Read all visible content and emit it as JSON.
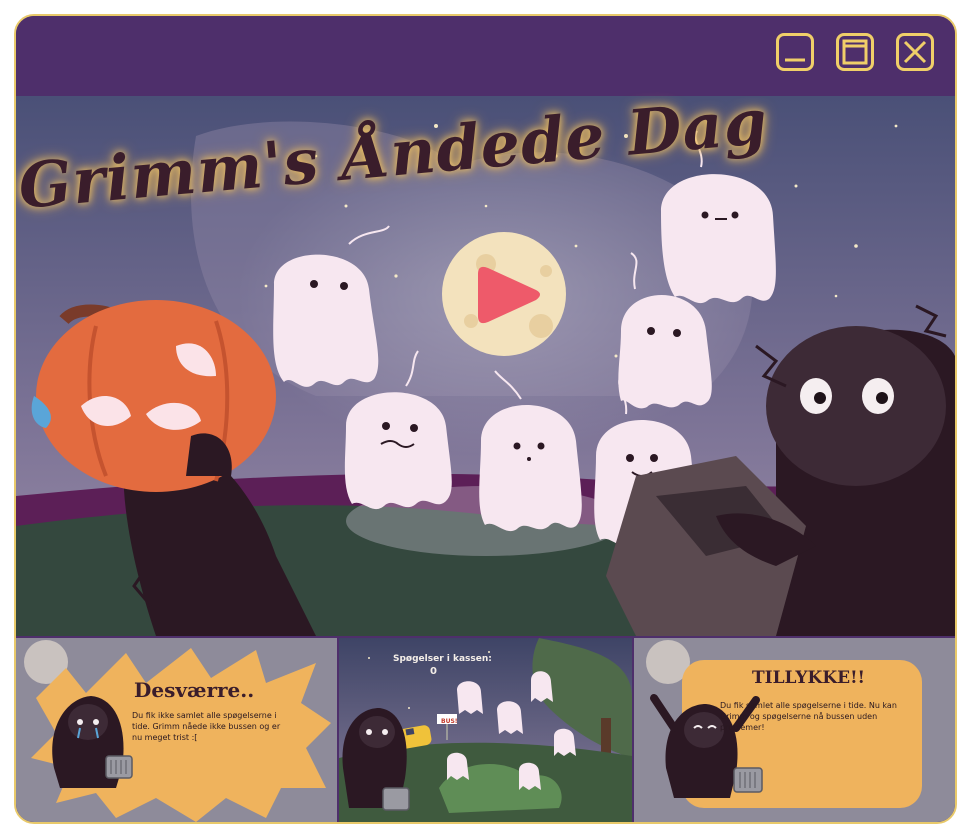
{
  "window": {
    "controls": [
      "minimize-icon",
      "maximize-icon",
      "close-icon"
    ],
    "accent": "#f0cf69",
    "frame_color": "#4e2f6b"
  },
  "hero": {
    "title": "Grimm's Åndede Dag",
    "play_button": "play-icon"
  },
  "lose_screen": {
    "title": "Desværre..",
    "text": "Du fik ikke samlet alle spøgelserne i tide. Grimm nåede ikke bussen og er nu meget trist :["
  },
  "gameplay_screen": {
    "counter_label": "Spøgelser i kassen:",
    "counter_value": "0",
    "bus_sign": "BUS!"
  },
  "win_screen": {
    "title": "TILLYKKE!!",
    "text": "Du fik samlet alle spøgelserne i tide. Nu kan Grimm og spøgelserne nå bussen uden problemer!"
  }
}
